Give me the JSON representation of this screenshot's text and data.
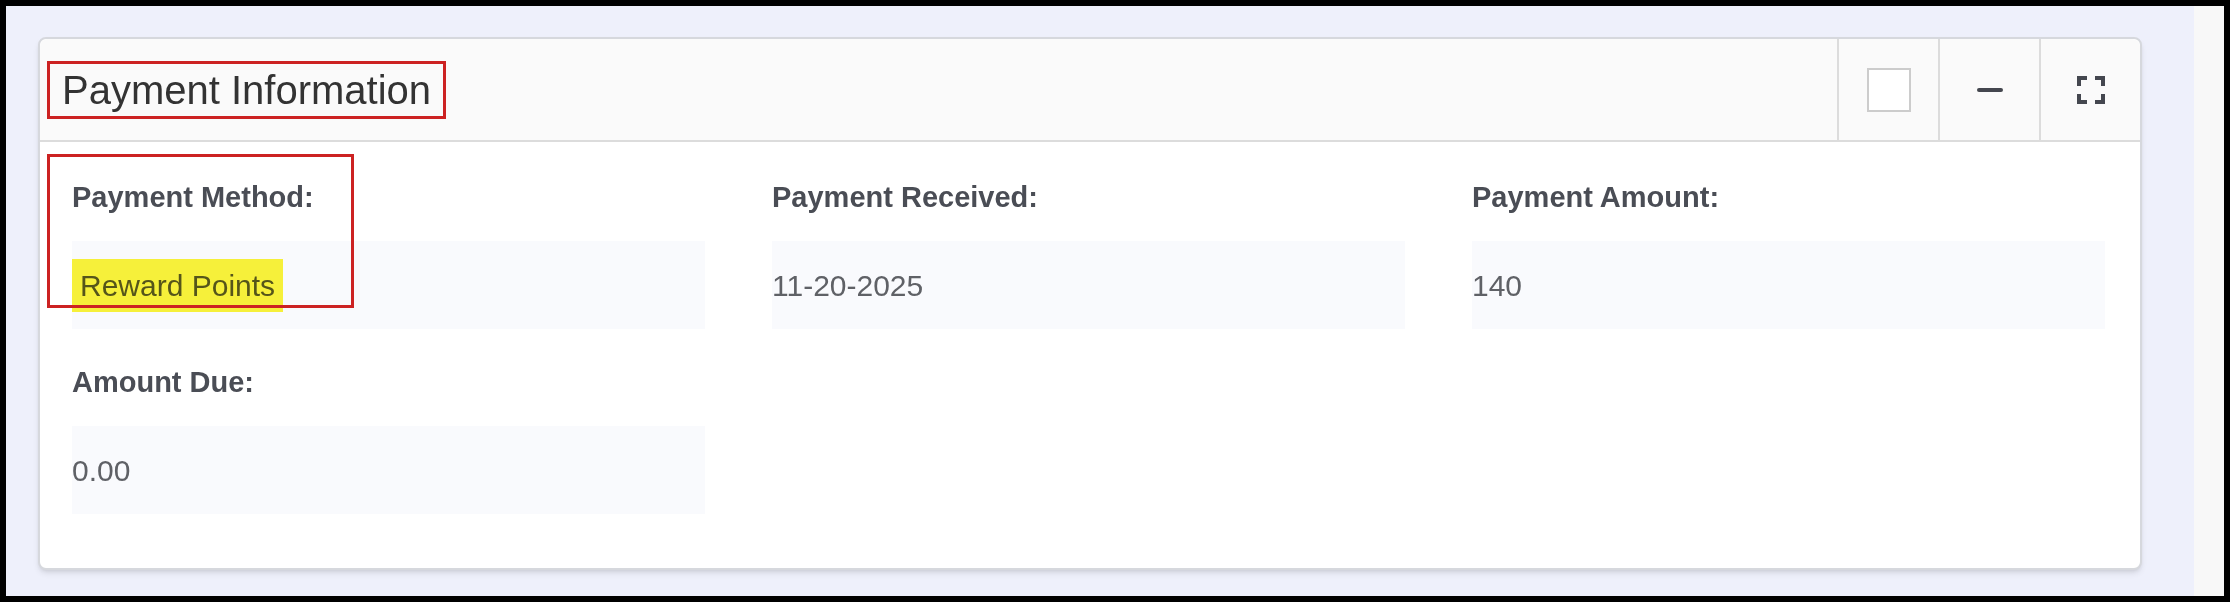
{
  "panel": {
    "title": "Payment Information",
    "title_outlined": true,
    "header_controls": [
      {
        "kind": "checkbox",
        "checked": false
      },
      {
        "kind": "collapse"
      },
      {
        "kind": "fullscreen"
      }
    ],
    "fields": [
      {
        "label": "Payment Method:",
        "value": "Reward Points",
        "highlighted": true,
        "outlined": true
      },
      {
        "label": "Payment Received:",
        "value": "11-20-2025",
        "highlighted": false,
        "outlined": false
      },
      {
        "label": "Payment Amount:",
        "value": "140",
        "highlighted": false,
        "outlined": false
      },
      {
        "label": "Amount Due:",
        "value": "0.00",
        "highlighted": false,
        "outlined": false
      }
    ]
  }
}
